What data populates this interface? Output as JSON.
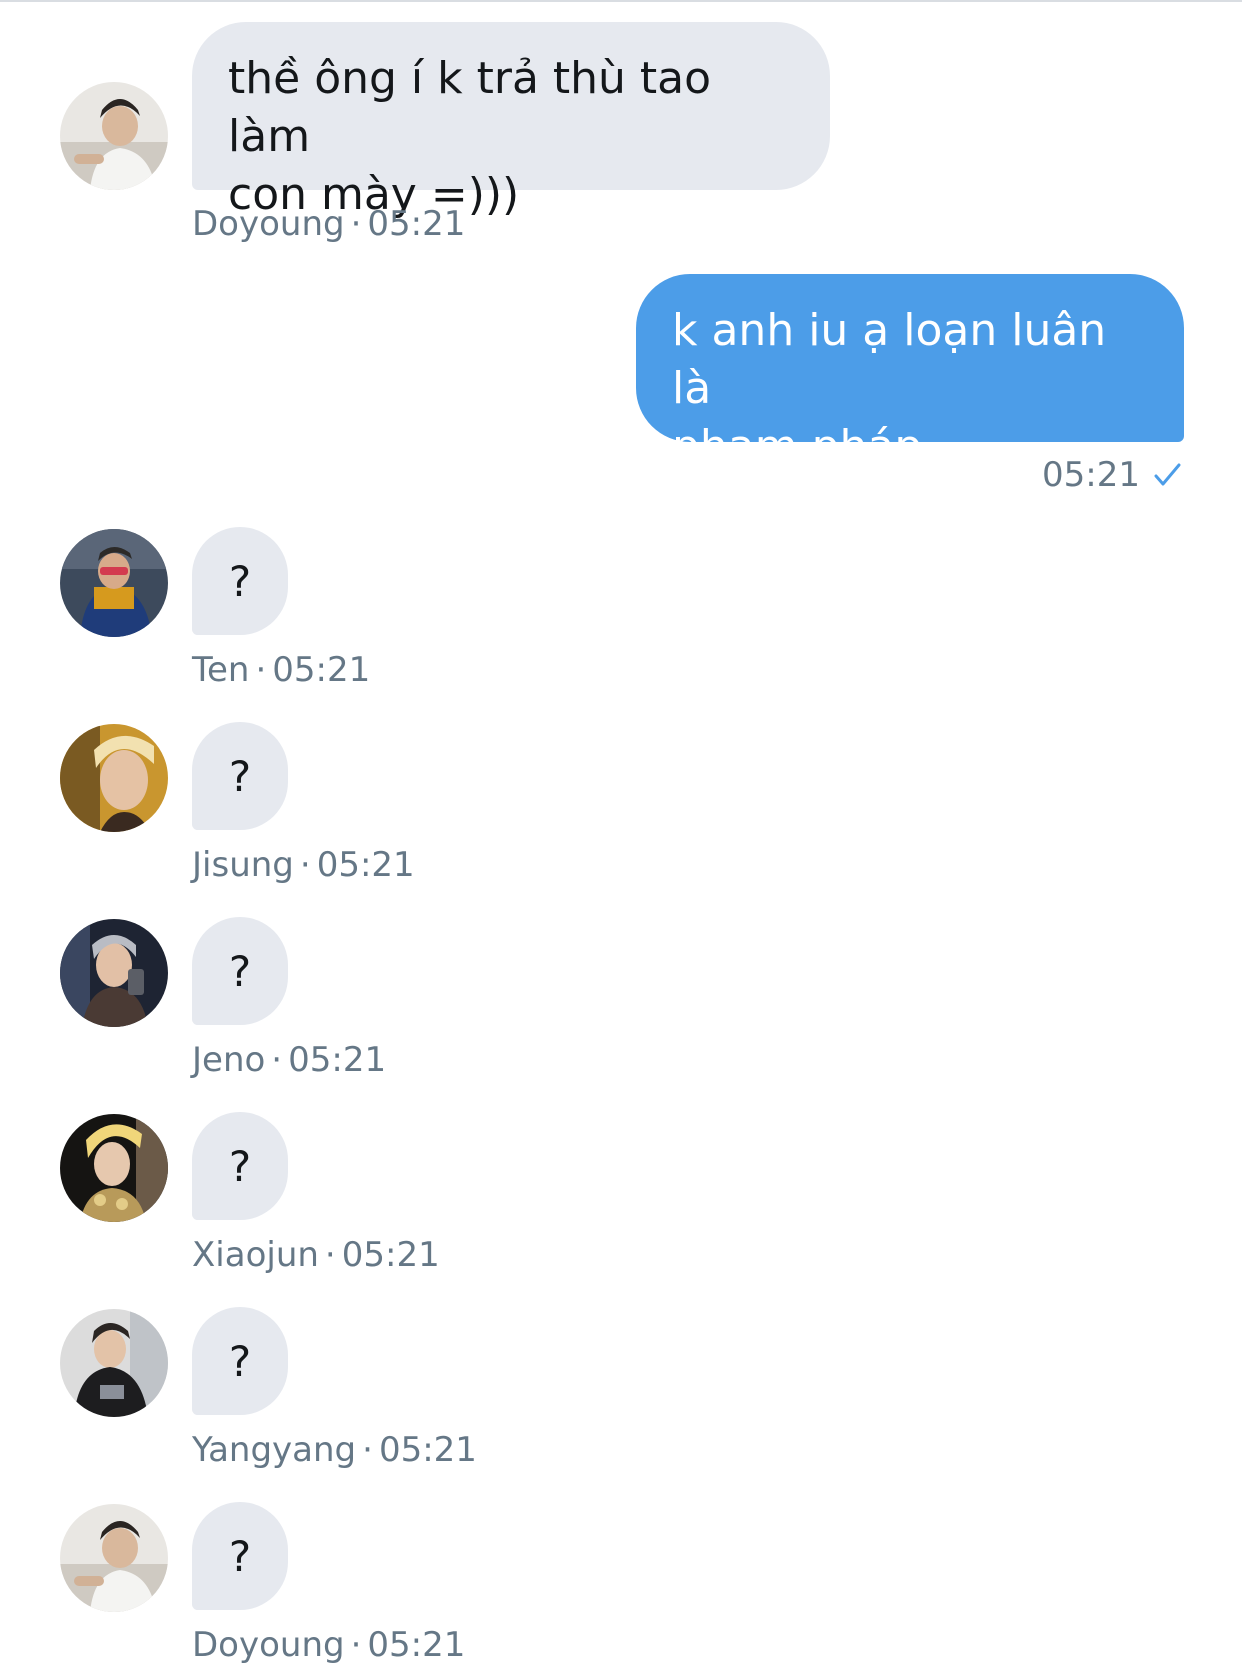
{
  "colors": {
    "incoming_bubble": "#e6e9ef",
    "outgoing_bubble": "#4c9de8",
    "meta_text": "#657786",
    "check": "#4c9de8"
  },
  "messages": [
    {
      "sender": "Doyoung",
      "time": "05:21",
      "text": "thề ông í k trả thù tao làm\ncon mày =)))",
      "avatar_icon": "avatar-doyoung"
    },
    {
      "outgoing": true,
      "time": "05:21",
      "text": "k anh iu ạ loạn luân là\nphạm pháp",
      "status_icon": "check-icon"
    },
    {
      "sender": "Ten",
      "time": "05:21",
      "text": "?",
      "avatar_icon": "avatar-ten"
    },
    {
      "sender": "Jisung",
      "time": "05:21",
      "text": "?",
      "avatar_icon": "avatar-jisung"
    },
    {
      "sender": "Jeno",
      "time": "05:21",
      "text": "?",
      "avatar_icon": "avatar-jeno"
    },
    {
      "sender": "Xiaojun",
      "time": "05:21",
      "text": "?",
      "avatar_icon": "avatar-xiaojun"
    },
    {
      "sender": "Yangyang",
      "time": "05:21",
      "text": "?",
      "avatar_icon": "avatar-yangyang"
    },
    {
      "sender": "Doyoung",
      "time": "05:21",
      "text": "?",
      "avatar_icon": "avatar-doyoung"
    }
  ],
  "separator": "·"
}
